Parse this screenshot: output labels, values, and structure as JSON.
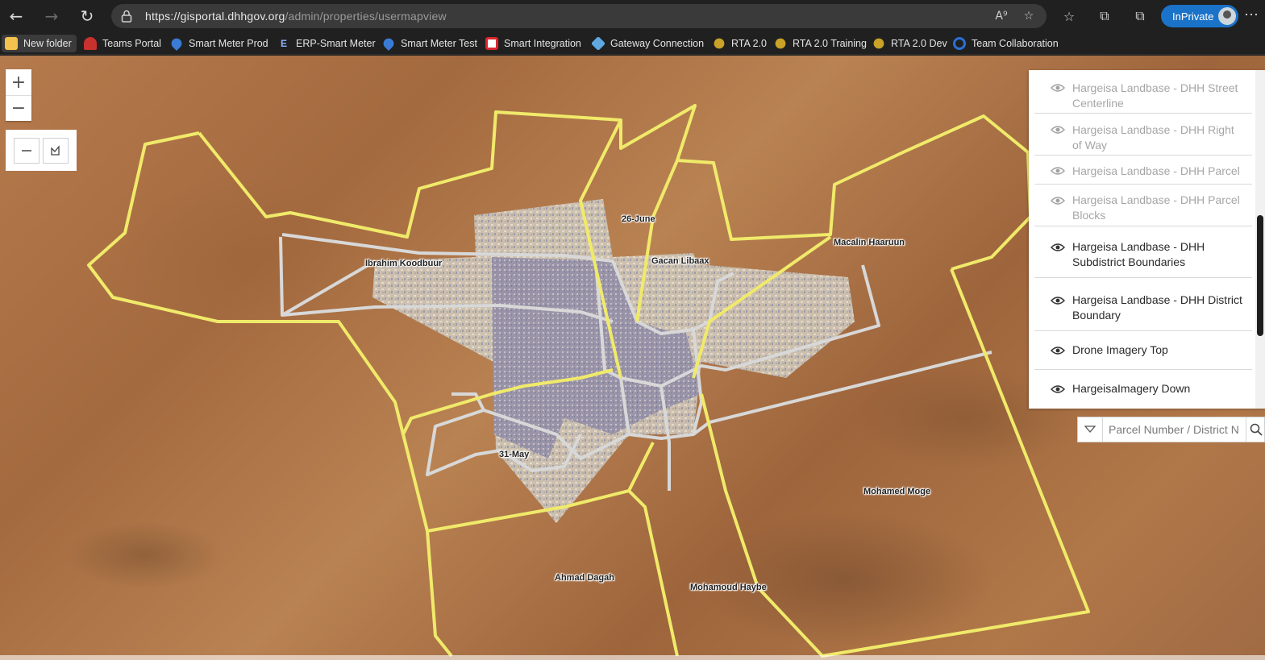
{
  "browser": {
    "url_host": "https://gisportal.dhhgov.org",
    "url_path": "/admin/properties/usermapview",
    "inprivate_label": "InPrivate",
    "icons": {
      "back": "back-arrow-icon",
      "forward": "forward-arrow-icon",
      "refresh": "refresh-icon",
      "lock": "lock-icon",
      "read_aloud": "read-aloud-icon",
      "add_favorite": "add-favorite-icon",
      "favorites": "favorites-icon",
      "collections": "collections-icon",
      "browser_essentials": "browser-essentials-icon",
      "menu": "more-menu-icon"
    }
  },
  "bookmarks": [
    {
      "label": "New folder",
      "icon": "folder-icon",
      "color": "#f2c14e"
    },
    {
      "label": "Teams Portal",
      "icon": "teams-icon",
      "color": "#c8312e"
    },
    {
      "label": "Smart Meter Prod",
      "icon": "water-drop-icon",
      "color": "#3a7bd5"
    },
    {
      "label": "ERP-Smart Meter",
      "icon": "erp-icon",
      "color": "#3a7bd5"
    },
    {
      "label": "Smart Meter Test",
      "icon": "water-drop-icon",
      "color": "#3a7bd5"
    },
    {
      "label": "Smart Integration",
      "icon": "integration-icon",
      "color": "#d9272e"
    },
    {
      "label": "Gateway Connection",
      "icon": "gateway-icon",
      "color": "#5fa8e0"
    },
    {
      "label": "RTA 2.0",
      "icon": "rta-icon",
      "color": "#c9a227"
    },
    {
      "label": "RTA 2.0 Training",
      "icon": "rta-icon",
      "color": "#c9a227"
    },
    {
      "label": "RTA 2.0 Dev",
      "icon": "rta-icon",
      "color": "#c9a227"
    },
    {
      "label": "Team Collaboration",
      "icon": "collaboration-icon",
      "color": "#2b6fd6"
    }
  ],
  "map": {
    "labels": [
      {
        "text": "26-June"
      },
      {
        "text": "Ibrahim Koodbuur"
      },
      {
        "text": "Gacan Libaax"
      },
      {
        "text": "Macalin Haaruun"
      },
      {
        "text": "31-May"
      },
      {
        "text": "Mohamed Moge"
      },
      {
        "text": "Ahmad Dagah"
      },
      {
        "text": "Mohamoud Haybe"
      }
    ],
    "district_boundary_color": "#f0ea6a",
    "subdistrict_boundary_color": "#d8d8d8"
  },
  "layers": [
    {
      "label": "Hargeisa Landbase - DHH Street Centerline",
      "enabled": false
    },
    {
      "label": "Hargeisa Landbase - DHH Right of Way",
      "enabled": false
    },
    {
      "label": "Hargeisa Landbase - DHH Parcel",
      "enabled": false
    },
    {
      "label": "Hargeisa Landbase - DHH Parcel Blocks",
      "enabled": false
    },
    {
      "label": "Hargeisa Landbase - DHH Subdistrict Boundaries",
      "enabled": true
    },
    {
      "label": "Hargeisa Landbase - DHH District Boundary",
      "enabled": true
    },
    {
      "label": "Drone Imagery Top",
      "enabled": true
    },
    {
      "label": "HargeisaImagery Down",
      "enabled": true
    }
  ],
  "search": {
    "placeholder": "Parcel Number / District N"
  }
}
